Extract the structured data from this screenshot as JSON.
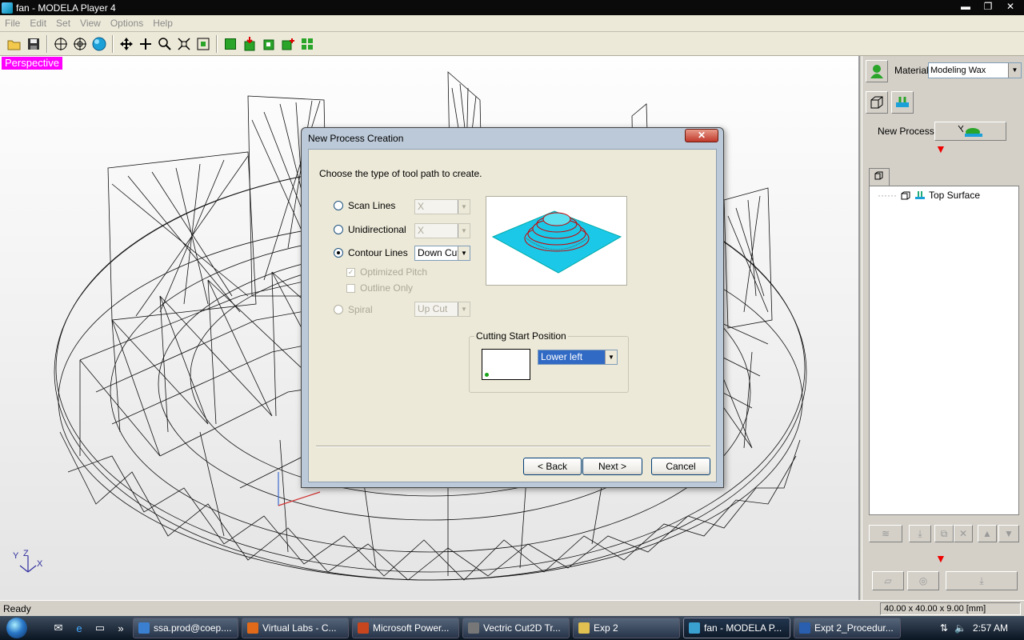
{
  "window": {
    "title": "fan - MODELA Player 4",
    "min": "▬",
    "max": "❐",
    "close": "✕"
  },
  "menu": [
    "File",
    "Edit",
    "Set",
    "View",
    "Options",
    "Help"
  ],
  "viewport": {
    "mode_label": "Perspective",
    "axis_y": "Y",
    "axis_z": "Z",
    "axis_x": "X"
  },
  "right_panel": {
    "material_label": "Material",
    "material_value": "Modeling Wax",
    "new_process_label": "New Process",
    "tree_item": "Top Surface"
  },
  "status": {
    "left": "Ready",
    "right": "40.00 x 40.00 x 9.00 [mm]"
  },
  "dialog": {
    "title": "New Process Creation",
    "close": "✕",
    "prompt": "Choose the type of tool path to create.",
    "options": {
      "scan_lines": {
        "label": "Scan Lines",
        "value": "X"
      },
      "unidirectional": {
        "label": "Unidirectional",
        "value": "X"
      },
      "contour_lines": {
        "label": "Contour Lines",
        "value": "Down Cut"
      },
      "spiral": {
        "label": "Spiral",
        "value": "Up Cut"
      }
    },
    "optimized_pitch": "Optimized Pitch",
    "outline_only": "Outline Only",
    "cutting_start": {
      "legend": "Cutting Start Position",
      "value": "Lower left"
    },
    "buttons": {
      "back": "< Back",
      "next": "Next >",
      "cancel": "Cancel"
    }
  },
  "taskbar": {
    "tasks": [
      {
        "label": "ssa.prod@coep....",
        "color": "#3a7fd0"
      },
      {
        "label": "Virtual Labs - C...",
        "color": "#e06a1a"
      },
      {
        "label": "Microsoft Power...",
        "color": "#c8461e"
      },
      {
        "label": "Vectric Cut2D Tr...",
        "color": "#777777"
      },
      {
        "label": "Exp 2",
        "color": "#e0c050"
      },
      {
        "label": "fan - MODELA P...",
        "color": "#3aa0d0"
      },
      {
        "label": "Expt 2_Procedur...",
        "color": "#2a5fb0"
      }
    ],
    "clock": "2:57 AM"
  }
}
